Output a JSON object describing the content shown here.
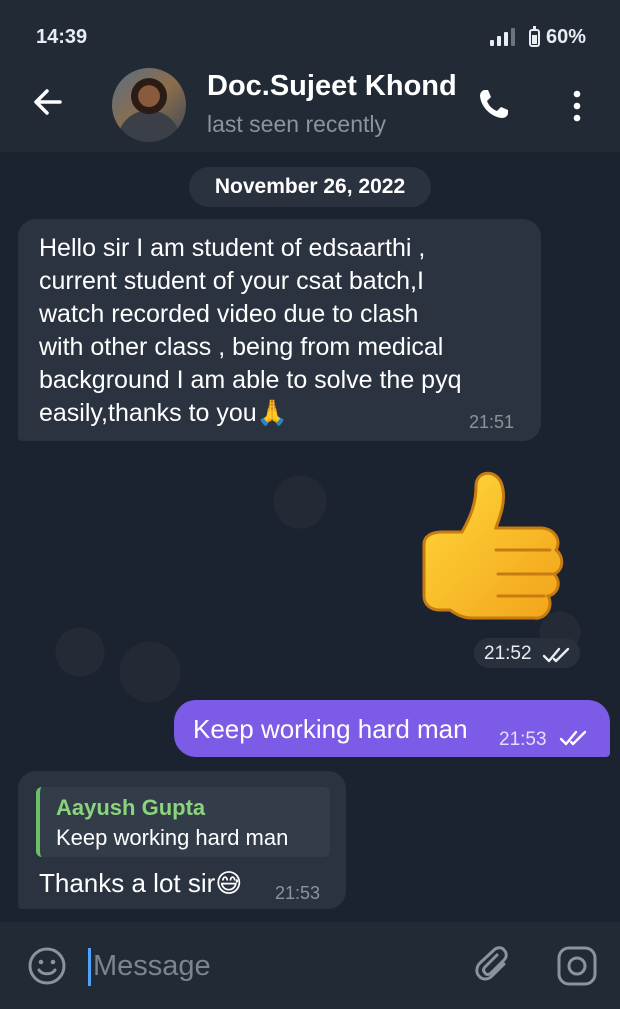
{
  "status_bar": {
    "time": "14:39",
    "battery": "60%",
    "battery_level": 0.6
  },
  "header": {
    "contact_name": "Doc.Sujeet Khond",
    "contact_status": "last seen recently"
  },
  "chat": {
    "date_separator": "November 26, 2022",
    "messages": [
      {
        "direction": "incoming",
        "text": "Hello sir I am student of edsaarthi ,\ncurrent student of your csat batch,I\nwatch recorded video due to clash\nwith other class , being from medical\nbackground I am able to  solve the pyq\neasily,thanks to you🙏",
        "time": "21:51"
      },
      {
        "direction": "outgoing",
        "type": "sticker",
        "sticker": "thumbs-up",
        "time": "21:52",
        "status": "read"
      },
      {
        "direction": "outgoing",
        "text": "Keep working hard man",
        "time": "21:53",
        "status": "read"
      },
      {
        "direction": "incoming",
        "reply_to": {
          "name": "Aayush Gupta",
          "text": "Keep working hard man"
        },
        "text": "Thanks a lot sir😅",
        "time": "21:53"
      }
    ]
  },
  "composer": {
    "placeholder": "Message"
  },
  "colors": {
    "outgoing_bubble": "#7c5be6",
    "incoming_bubble": "#2b3340",
    "reply_name": "#8bd37c",
    "background": "#1c2330"
  }
}
